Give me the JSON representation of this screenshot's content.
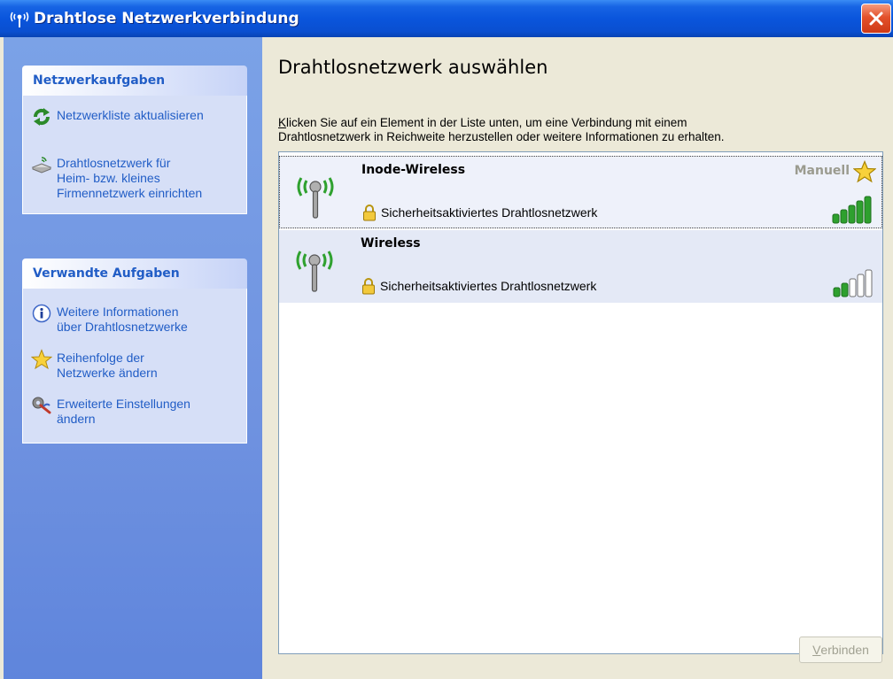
{
  "window": {
    "title": "Drahtlose Netzwerkverbindung"
  },
  "sidebar": {
    "sections": [
      {
        "header": "Netzwerkaufgaben",
        "items": [
          {
            "label_lines": [
              "Netzwerkliste aktualisieren"
            ],
            "icon": "refresh-icon"
          },
          {
            "label_lines": [
              "Drahtlosnetzwerk für",
              "Heim- bzw. kleines",
              "Firmennetzwerk einrichten"
            ],
            "icon": "wireless-setup-icon"
          }
        ]
      },
      {
        "header": "Verwandte Aufgaben",
        "items": [
          {
            "label_lines": [
              "Weitere Informationen",
              "über Drahtlosnetzwerke"
            ],
            "icon": "info-icon"
          },
          {
            "label_lines": [
              "Reihenfolge der",
              "Netzwerke ändern"
            ],
            "icon": "star-icon"
          },
          {
            "label_lines": [
              "Erweiterte Einstellungen",
              "ändern"
            ],
            "icon": "settings-icon"
          }
        ]
      }
    ]
  },
  "main": {
    "heading": "Drahtlosnetzwerk auswählen",
    "intro_first_letter": "K",
    "intro_line1_rest": "licken Sie auf ein Element in der Liste unten, um eine Verbindung mit einem",
    "intro_line2": "Drahtlosnetzwerk in Reichweite herzustellen oder weitere Informationen zu erhalten.",
    "networks": [
      {
        "ssid": "Inode-Wireless",
        "security": "Sicherheitsaktiviertes Drahtlosnetzwerk",
        "badge": "Manuell",
        "preferred": true,
        "selected": true,
        "signal_bars": 5
      },
      {
        "ssid": "Wireless",
        "security": "Sicherheitsaktiviertes Drahtlosnetzwerk",
        "badge": "",
        "preferred": false,
        "selected": false,
        "signal_bars": 2
      }
    ],
    "connect_first_letter": "V",
    "connect_rest": "erbinden"
  },
  "colors": {
    "titlebar": "#0a55dc",
    "task_link": "#215dc6",
    "signal_on": "#2ea02e",
    "signal_off": "#ffffff"
  }
}
